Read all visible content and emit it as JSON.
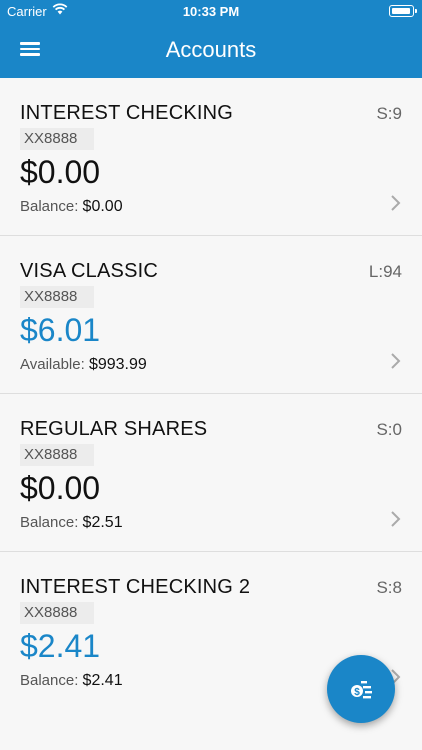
{
  "status_bar": {
    "carrier": "Carrier",
    "time": "10:33 PM"
  },
  "navbar": {
    "title": "Accounts"
  },
  "accounts": [
    {
      "name": "INTEREST CHECKING",
      "code": "S:9",
      "mask": "XX8888",
      "amount": "$0.00",
      "sub_label": "Balance:",
      "sub_value": "$0.00"
    },
    {
      "name": "VISA CLASSIC",
      "code": "L:94",
      "mask": "XX8888",
      "amount": "$6.01",
      "sub_label": "Available:",
      "sub_value": "$993.99"
    },
    {
      "name": "REGULAR SHARES",
      "code": "S:0",
      "mask": "XX8888",
      "amount": "$0.00",
      "sub_label": "Balance:",
      "sub_value": "$2.51"
    },
    {
      "name": "INTEREST CHECKING 2",
      "code": "S:8",
      "mask": "XX8888",
      "amount": "$2.41",
      "sub_label": "Balance:",
      "sub_value": "$2.41"
    }
  ],
  "colors": {
    "primary": "#1a86c8",
    "amount_dark": "#111111"
  }
}
